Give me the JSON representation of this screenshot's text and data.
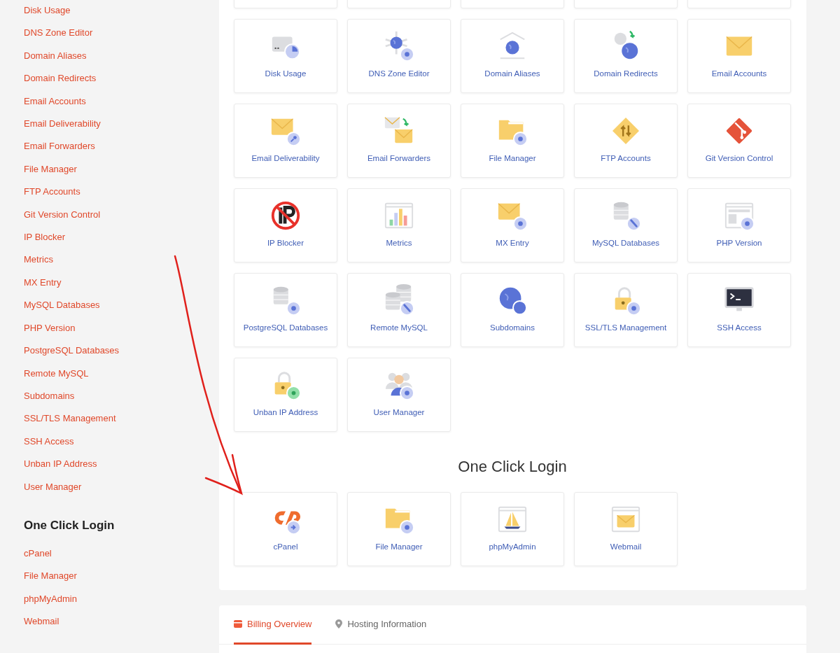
{
  "sidebar": {
    "links": [
      "Disk Usage",
      "DNS Zone Editor",
      "Domain Aliases",
      "Domain Redirects",
      "Email Accounts",
      "Email Deliverability",
      "Email Forwarders",
      "File Manager",
      "FTP Accounts",
      "Git Version Control",
      "IP Blocker",
      "Metrics",
      "MX Entry",
      "MySQL Databases",
      "PHP Version",
      "PostgreSQL Databases",
      "Remote MySQL",
      "Subdomains",
      "SSL/TLS Management",
      "SSH Access",
      "Unban IP Address",
      "User Manager"
    ],
    "login_heading": "One Click Login",
    "login_links": [
      "cPanel",
      "File Manager",
      "phpMyAdmin",
      "Webmail"
    ]
  },
  "tools": {
    "tiles": [
      "Disk Usage",
      "DNS Zone Editor",
      "Domain Aliases",
      "Domain Redirects",
      "Email Accounts",
      "Email Deliverability",
      "Email Forwarders",
      "File Manager",
      "FTP Accounts",
      "Git Version Control",
      "IP Blocker",
      "Metrics",
      "MX Entry",
      "MySQL Databases",
      "PHP Version",
      "PostgreSQL Databases",
      "Remote MySQL",
      "Subdomains",
      "SSL/TLS Management",
      "SSH Access",
      "Unban IP Address",
      "User Manager"
    ]
  },
  "one_click_login": {
    "heading": "One Click Login",
    "tiles": [
      "cPanel",
      "File Manager",
      "phpMyAdmin",
      "Webmail"
    ]
  },
  "tabs": [
    {
      "label": "Billing Overview",
      "selected": true
    },
    {
      "label": "Hosting Information",
      "selected": false
    }
  ]
}
